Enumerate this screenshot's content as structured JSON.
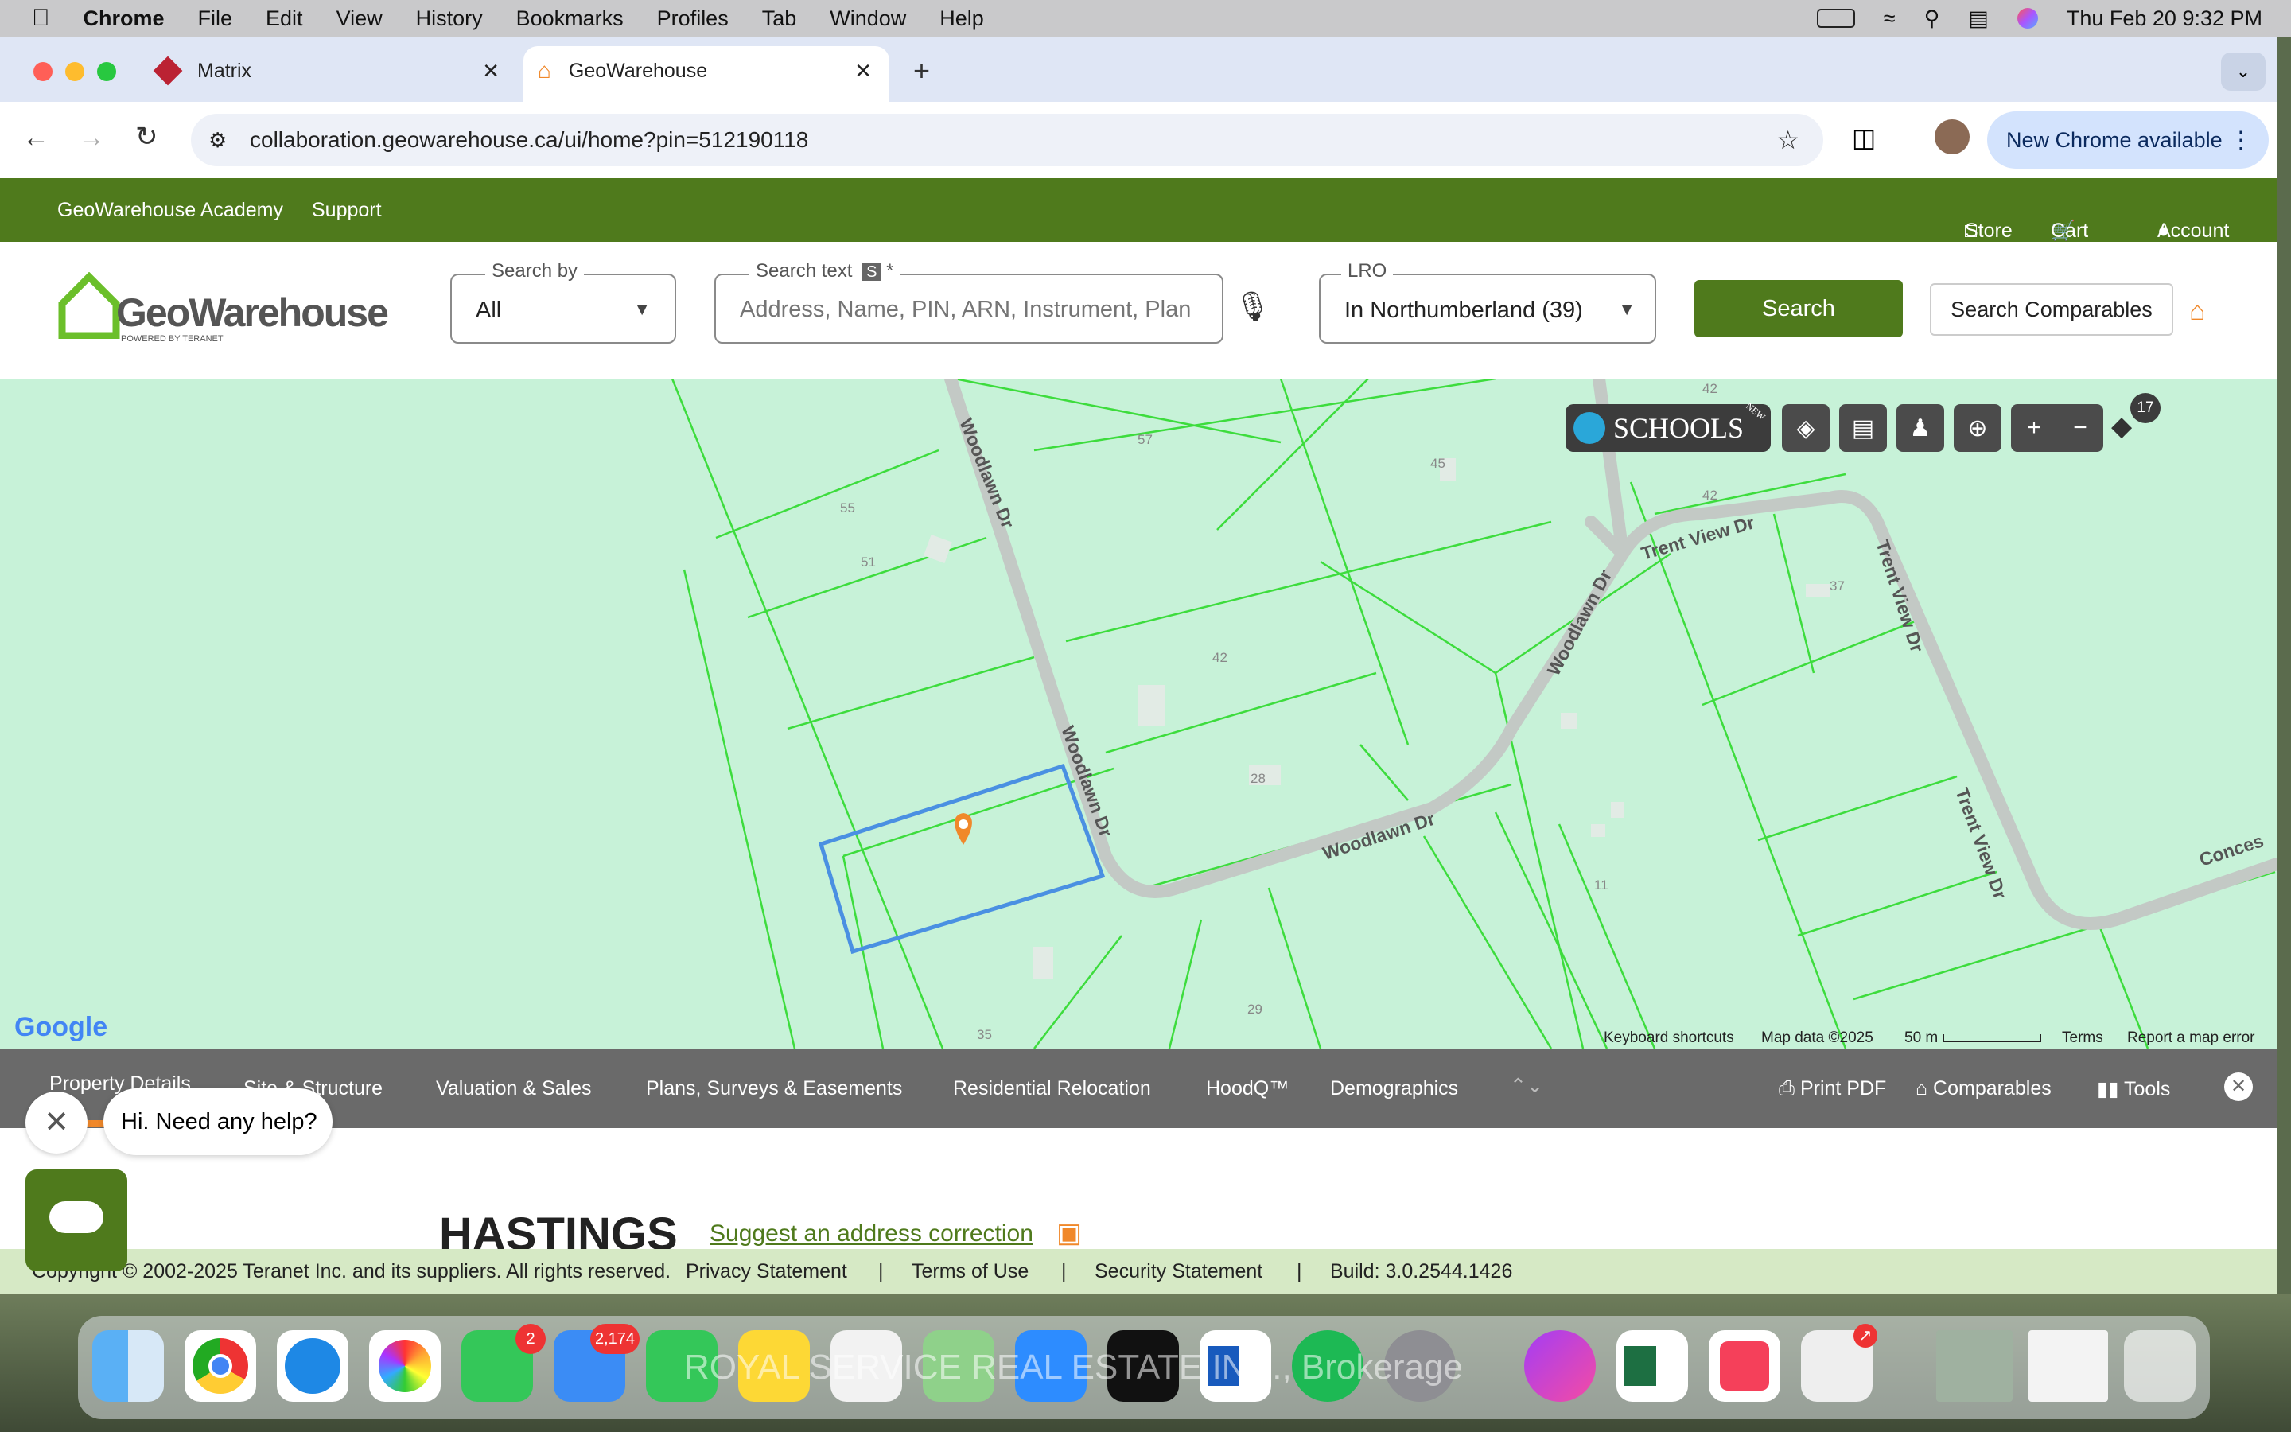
{
  "menubar": {
    "app": "Chrome",
    "items": [
      "File",
      "Edit",
      "View",
      "History",
      "Bookmarks",
      "Profiles",
      "Tab",
      "Window",
      "Help"
    ],
    "datetime": "Thu Feb 20  9:32 PM"
  },
  "browser": {
    "tabs": [
      {
        "label": "Matrix"
      },
      {
        "label": "GeoWarehouse"
      }
    ],
    "url": "collaboration.geowarehouse.ca/ui/home?pin=512190118",
    "update_label": "New Chrome available"
  },
  "site_nav": {
    "academy": "GeoWarehouse Academy",
    "support": "Support",
    "store": "Store",
    "cart": "Cart (0)",
    "account": "Account"
  },
  "logo": {
    "name": "GeoWarehouse",
    "tagline": "POWERED BY TERANET"
  },
  "search": {
    "search_by_label": "Search by",
    "search_by_value": "All",
    "text_label": "Search text",
    "text_badge": "S",
    "text_required": "*",
    "placeholder": "Address, Name, PIN, ARN, Instrument, Plan",
    "lro_label": "LRO",
    "lro_value": "In Northumberland (39)",
    "search_button": "Search",
    "comparables_button": "Search Comparables"
  },
  "map": {
    "schools_label": "SCHOOLS",
    "schools_badge": "NEW",
    "layers_count": "17",
    "streets": [
      "Woodlawn Dr",
      "Woodlawn Dr",
      "Woodlawn Dr",
      "Woodlawn Dr",
      "Trent View Dr",
      "Trent View Dr",
      "Trent View Dr",
      "Conces"
    ],
    "lot_numbers": [
      "57",
      "42",
      "45",
      "42",
      "55",
      "51",
      "37",
      "42",
      "28",
      "11",
      "29",
      "35"
    ],
    "footer": {
      "google": "Google",
      "shortcuts": "Keyboard shortcuts",
      "map_data": "Map data ©2025",
      "scale": "50 m",
      "terms": "Terms",
      "report": "Report a map error"
    }
  },
  "property_tabs": {
    "items": [
      "Property Details",
      "Site & Structure",
      "Valuation & Sales",
      "Plans, Surveys & Easements",
      "Residential Relocation",
      "HoodQ™",
      "Demographics"
    ],
    "print": "Print PDF",
    "comparables": "Comparables",
    "tools": "Tools"
  },
  "content": {
    "heading": "HASTINGS",
    "suggest_link": "Suggest an address correction"
  },
  "footer": {
    "copyright": "Copyright © 2002-2025 Teranet Inc. and its suppliers. All rights reserved.",
    "privacy": "Privacy Statement",
    "terms": "Terms of Use",
    "security": "Security Statement",
    "build": "Build: 3.0.2544.1426"
  },
  "chat": {
    "prompt": "Hi. Need any help?"
  },
  "dock": {
    "messages_badge": "2",
    "mail_badge": "2,174",
    "watermark": "ROYAL SERVICE REAL ESTATE INC., Brokerage"
  },
  "colors": {
    "brand_green": "#4f7a1c",
    "map_bg": "#c7f2d8",
    "parcel_line": "#3ddc3d",
    "selected_parcel": "#4a90e2",
    "pin": "#f0882a"
  }
}
